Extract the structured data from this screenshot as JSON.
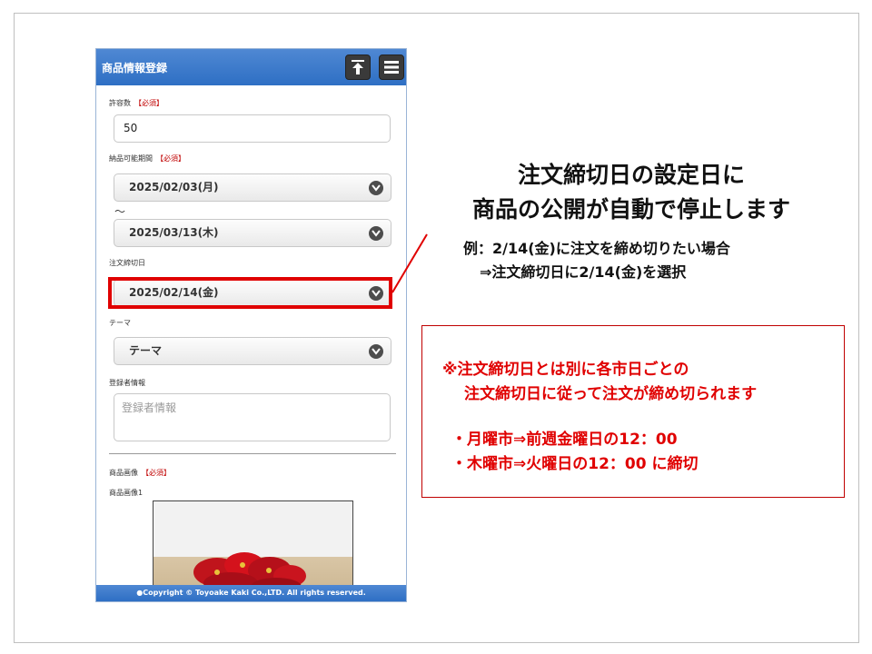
{
  "app": {
    "title": "商品情報登録",
    "upload_icon": "upload-icon",
    "menu_icon": "hamburger-menu-icon",
    "header_color": "#2e6fc4"
  },
  "form": {
    "quantity_label": "許容数",
    "required_tag": "【必須】",
    "quantity_value": "50",
    "delivery_period_label": "納品可能期間",
    "delivery_start": "2025/02/03(月)",
    "delivery_separator": "～",
    "delivery_end": "2025/03/13(木)",
    "order_deadline_label": "注文締切日",
    "order_deadline_value": "2025/02/14(金)",
    "theme_label": "テーマ",
    "theme_value": "テーマ",
    "registrant_label": "登録者情報",
    "registrant_placeholder": "登録者情報",
    "image_label": "商品画像",
    "image1_label": "商品画像1"
  },
  "footer": {
    "copyright": "●Copyright © Toyoake Kaki Co.,LTD. All rights reserved."
  },
  "annotation": {
    "headline_1": "注文締切日の設定日に",
    "headline_2": "商品の公開が自動で停止します",
    "example_1": "例：2/14(金)に注文を締め切りたい場合",
    "example_2": "⇒注文締切日に2/14(金)を選択",
    "highlight_color": "#e00000"
  },
  "notice": {
    "line_1": "※注文締切日とは別に各市日ごとの",
    "line_2": "注文締切日に従って注文が締め切られます",
    "line_3": "・月曜市⇒前週金曜日の12：00",
    "line_4": "・木曜市⇒火曜日の12：00 に締切",
    "text_color": "#e00000"
  }
}
